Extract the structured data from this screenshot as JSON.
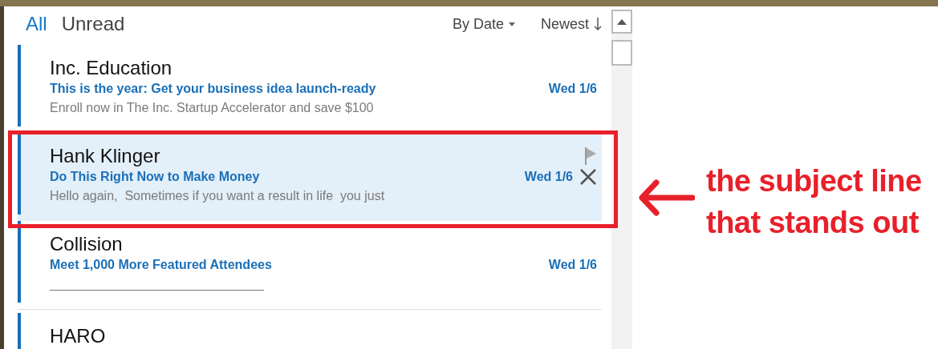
{
  "tabs": [
    {
      "label": "All",
      "selected": true
    },
    {
      "label": "Unread",
      "selected": false
    }
  ],
  "sort": {
    "field": "By Date",
    "order": "Newest"
  },
  "messages": [
    {
      "sender": "Inc. Education",
      "subject": "This is the year: Get your business idea launch-ready",
      "date": "Wed 1/6",
      "preview": "Enroll now in The Inc. Startup Accelerator and save $100",
      "unread": true,
      "selected": false
    },
    {
      "sender": "Hank Klinger",
      "subject": "Do This Right Now to Make Money",
      "date": "Wed 1/6",
      "preview": "Hello again,  Sometimes if you want a result in life  you just",
      "unread": true,
      "selected": true
    },
    {
      "sender": "Collision",
      "subject": "Meet 1,000 More Featured Attendees",
      "date": "Wed 1/6",
      "preview": "______________________________",
      "unread": true,
      "selected": false
    },
    {
      "sender": "HARO",
      "unread": true,
      "selected": false
    }
  ],
  "annotation": {
    "text": "the subject line\nthat stands out"
  }
}
